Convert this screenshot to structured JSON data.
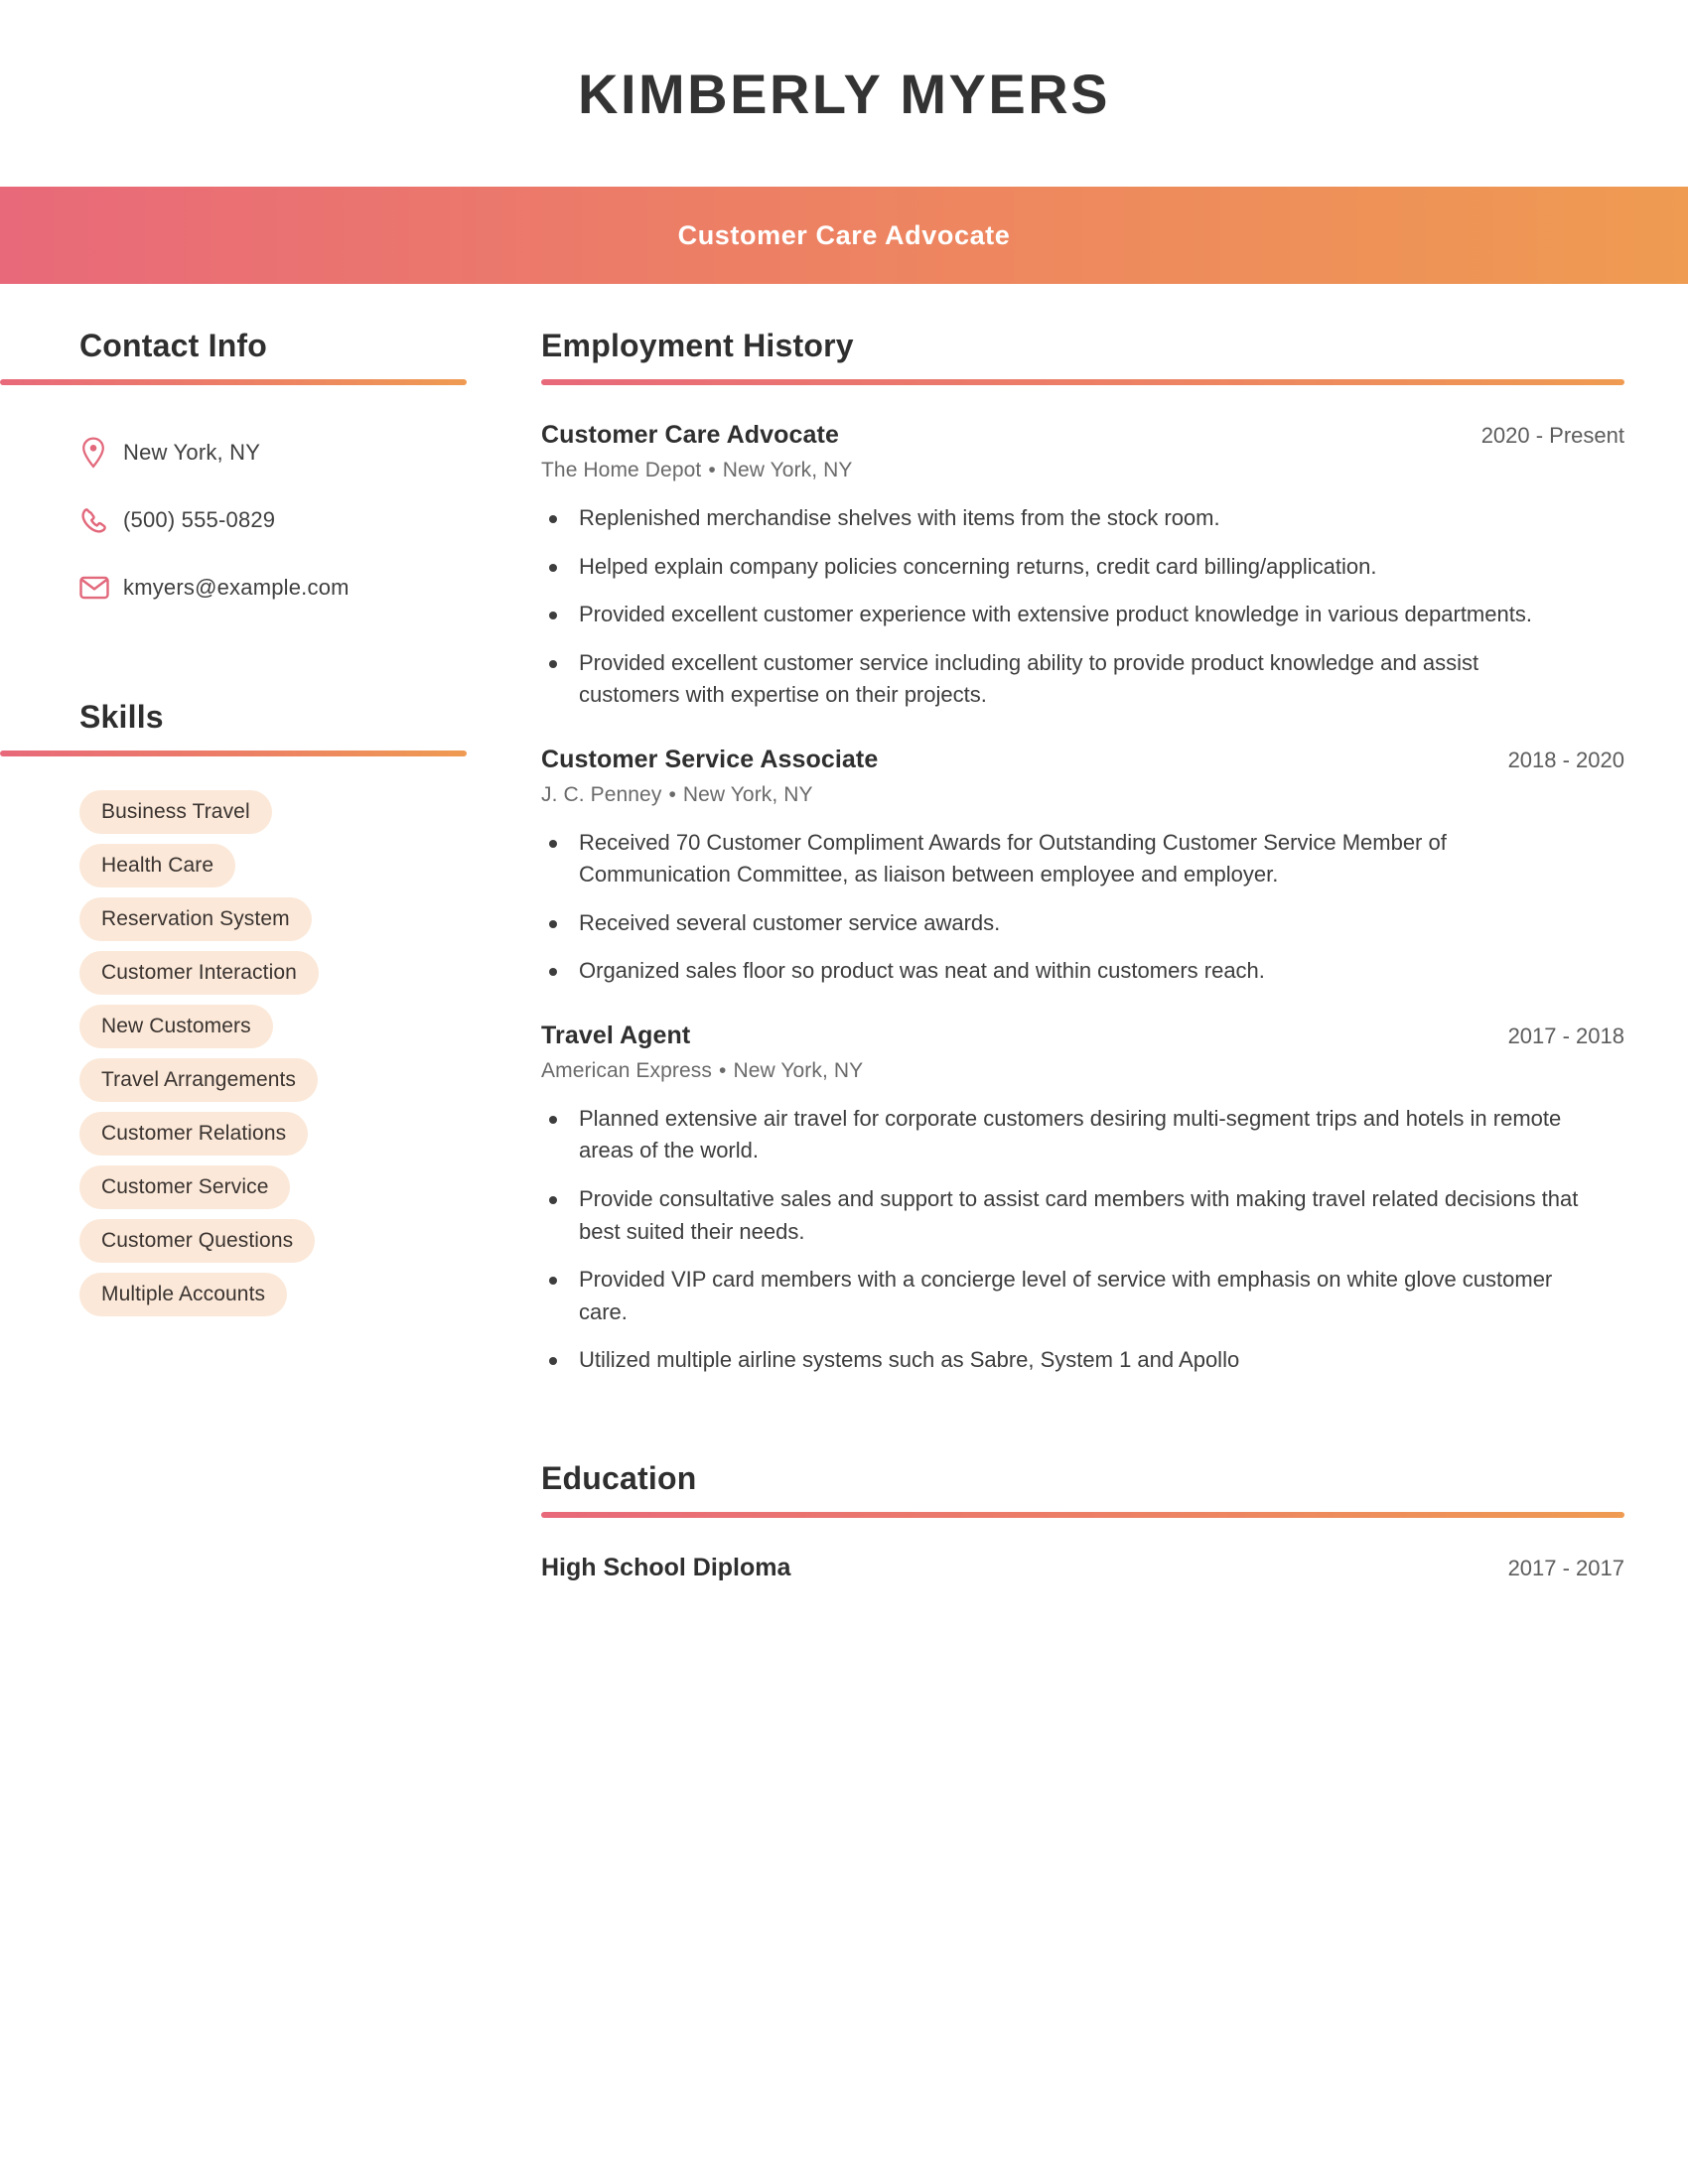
{
  "header": {
    "full_name": "KIMBERLY MYERS",
    "job_title": "Customer Care Advocate"
  },
  "theme": {
    "gradient_start": "#e8697a",
    "gradient_end": "#ef9b52",
    "skill_pill_bg": "#fbe8d8",
    "heading_color": "#2f2f2f"
  },
  "sidebar": {
    "contact": {
      "heading": "Contact Info",
      "items": [
        {
          "icon": "location-pin-icon",
          "value": "New York, NY"
        },
        {
          "icon": "phone-icon",
          "value": "(500) 555-0829"
        },
        {
          "icon": "envelope-icon",
          "value": "kmyers@example.com"
        }
      ]
    },
    "skills": {
      "heading": "Skills",
      "items": [
        "Business Travel",
        "Health Care",
        "Reservation System",
        "Customer Interaction",
        "New Customers",
        "Travel Arrangements",
        "Customer Relations",
        "Customer Service",
        "Customer Questions",
        "Multiple Accounts"
      ]
    }
  },
  "main": {
    "employment": {
      "heading": "Employment History",
      "entries": [
        {
          "role": "Customer Care Advocate",
          "dates": "2020 - Present",
          "company": "The Home Depot",
          "location": "New York, NY",
          "bullets": [
            "Replenished merchandise shelves with items from the stock room.",
            "Helped explain company policies concerning returns, credit card billing/application.",
            "Provided excellent customer experience with extensive product knowledge in various departments.",
            "Provided excellent customer service including ability to provide product knowledge and assist customers with expertise on their projects."
          ]
        },
        {
          "role": "Customer Service Associate",
          "dates": "2018 - 2020",
          "company": "J. C. Penney",
          "location": "New York, NY",
          "bullets": [
            "Received 70 Customer Compliment Awards for Outstanding Customer Service Member of Communication Committee, as liaison between employee and employer.",
            "Received several customer service awards.",
            "Organized sales floor so product was neat and within customers reach."
          ]
        },
        {
          "role": "Travel Agent",
          "dates": "2017 - 2018",
          "company": "American Express",
          "location": "New York, NY",
          "bullets": [
            "Planned extensive air travel for corporate customers desiring multi-segment trips and hotels in remote areas of the world.",
            "Provide consultative sales and support to assist card members with making travel related decisions that best suited their needs.",
            "Provided VIP card members with a concierge level of service with emphasis on white glove customer care.",
            "Utilized multiple airline systems such as Sabre, System 1 and Apollo"
          ]
        }
      ]
    },
    "education": {
      "heading": "Education",
      "entries": [
        {
          "degree": "High School Diploma",
          "dates": "2017 - 2017"
        }
      ]
    }
  }
}
